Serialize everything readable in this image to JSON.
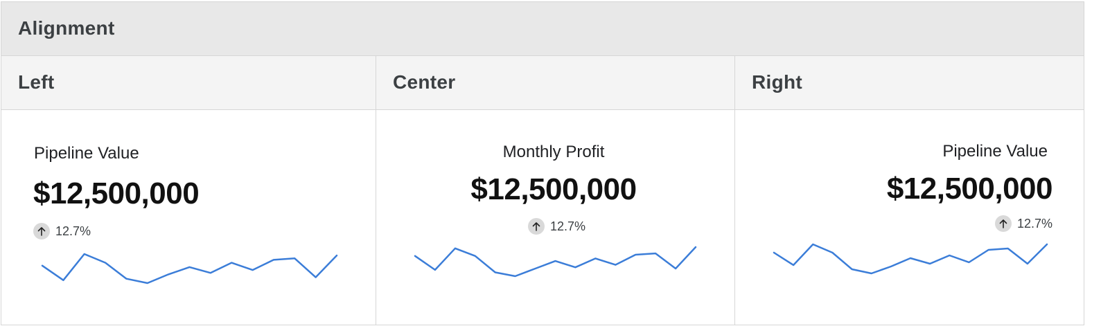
{
  "table": {
    "caption": "Alignment",
    "columns": [
      "Left",
      "Center",
      "Right"
    ]
  },
  "cards": [
    {
      "alignment": "left",
      "title": "Pipeline Value",
      "value": "$12,500,000",
      "delta": "12.7%",
      "delta_direction": "up",
      "sparkline": [
        14,
        4,
        22,
        16,
        5,
        2,
        8,
        13,
        9,
        16,
        11,
        18,
        19,
        6,
        21
      ]
    },
    {
      "alignment": "center",
      "title": "Monthly Profit",
      "value": "$12,500,000",
      "delta": "12.7%",
      "delta_direction": "up",
      "sparkline": [
        19,
        8,
        25,
        19,
        6,
        3,
        9,
        15,
        10,
        17,
        12,
        20,
        21,
        9,
        26
      ]
    },
    {
      "alignment": "right",
      "title": "Pipeline Value",
      "value": "$12,500,000",
      "delta": "12.7%",
      "delta_direction": "up",
      "sparkline": [
        17,
        8,
        23,
        17,
        5,
        2,
        7,
        13,
        9,
        15,
        10,
        19,
        20,
        9,
        23
      ]
    }
  ],
  "colors": {
    "sparkline": "#3b7dd8",
    "caption_bg": "#e8e8e8",
    "header_bg": "#f4f4f4",
    "border": "#d6d6d6",
    "delta_badge": "#d9d9d9"
  },
  "icons": {
    "delta": "arrow-up-icon"
  }
}
